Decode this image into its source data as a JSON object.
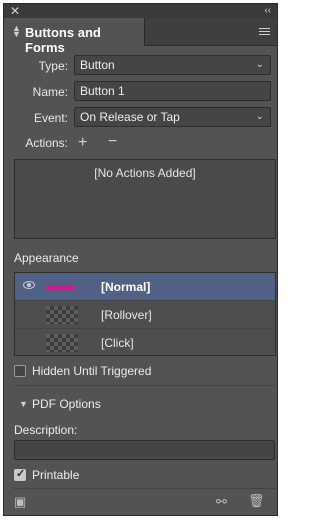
{
  "panel": {
    "tab_title": "Buttons and Forms"
  },
  "form": {
    "type_label": "Type:",
    "type_value": "Button",
    "name_label": "Name:",
    "name_value": "Button 1",
    "event_label": "Event:",
    "event_value": "On Release or Tap",
    "actions_label": "Actions:",
    "actions_empty": "[No Actions Added]"
  },
  "appearance": {
    "title": "Appearance",
    "states": [
      {
        "label": "[Normal]",
        "selected": true
      },
      {
        "label": "[Rollover]",
        "selected": false
      },
      {
        "label": "[Click]",
        "selected": false
      }
    ]
  },
  "hidden_until_triggered": {
    "label": "Hidden Until Triggered",
    "checked": false
  },
  "pdf_options": {
    "title": "PDF Options",
    "description_label": "Description:",
    "description_value": "",
    "printable_label": "Printable",
    "printable_checked": true
  },
  "colors": {
    "panel_bg": "#535353",
    "selection": "#4f6184",
    "normal_thumb": "#e0138c"
  }
}
